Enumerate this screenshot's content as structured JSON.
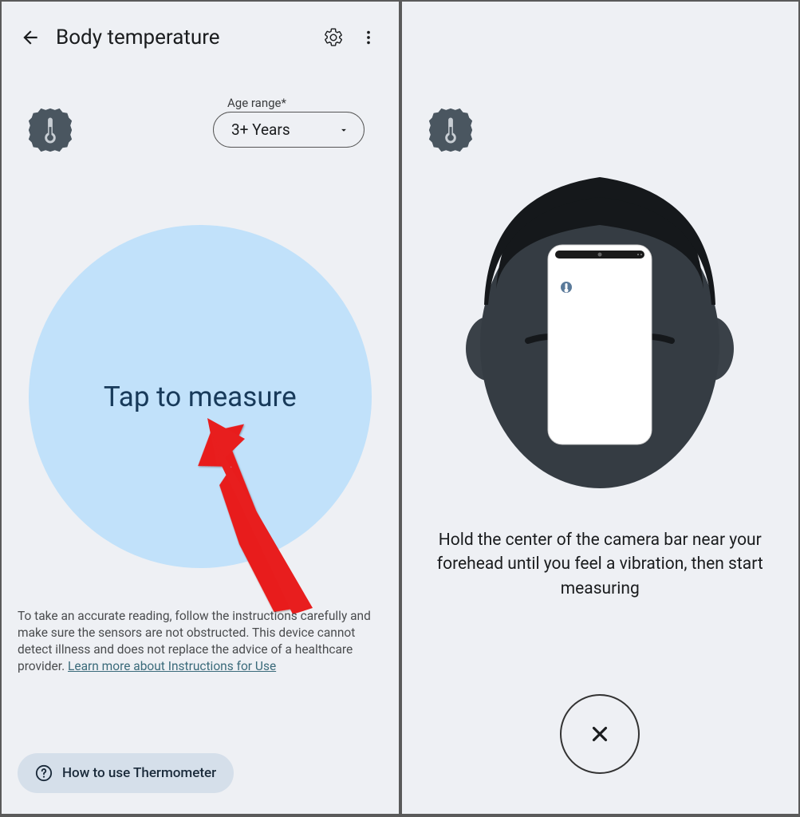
{
  "screen1": {
    "header": {
      "title": "Body temperature"
    },
    "age": {
      "label": "Age range*",
      "value": "3+ Years"
    },
    "measure_label": "Tap to measure",
    "disclaimer_text": "To take an accurate reading, follow the instructions carefully and make sure the sensors are not obstructed. This device cannot detect illness and does not replace the advice of a healthcare provider. ",
    "disclaimer_link": "Learn more about Instructions for Use",
    "howto_label": "How to use Thermometer"
  },
  "screen2": {
    "instruction": "Hold the center of the camera bar near your forehead until you feel a vibration, then start measuring"
  }
}
